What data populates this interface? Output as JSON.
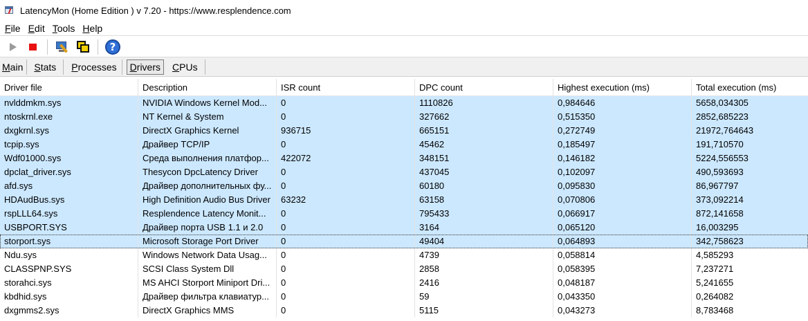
{
  "window": {
    "title": "LatencyMon  (Home Edition )  v 7.20 - https://www.resplendence.com"
  },
  "menu": [
    {
      "key": "F",
      "rest": "ile"
    },
    {
      "key": "E",
      "rest": "dit"
    },
    {
      "key": "T",
      "rest": "ools"
    },
    {
      "key": "H",
      "rest": "elp"
    }
  ],
  "toolbar": {
    "icons": [
      "play-icon",
      "stop-icon",
      "tools-icon",
      "windows-icon",
      "help-icon"
    ]
  },
  "tabs": [
    {
      "key": "M",
      "rest": "ain"
    },
    {
      "key": "S",
      "rest": "tats"
    },
    {
      "key": "P",
      "rest": "rocesses"
    },
    {
      "key": "D",
      "rest": "rivers"
    },
    {
      "key": "C",
      "rest": "PUs"
    }
  ],
  "active_tab": "Drivers",
  "columns": [
    "Driver file",
    "Description",
    "ISR count",
    "DPC count",
    "Highest execution (ms)",
    "Total execution (ms)"
  ],
  "rows": [
    {
      "file": "nvlddmkm.sys",
      "desc": "NVIDIA Windows Kernel Mod...",
      "isr": "0",
      "dpc": "1110826",
      "highest": "0,984646",
      "total": "5658,034305",
      "selected": true
    },
    {
      "file": "ntoskrnl.exe",
      "desc": "NT Kernel & System",
      "isr": "0",
      "dpc": "327662",
      "highest": "0,515350",
      "total": "2852,685223",
      "selected": true
    },
    {
      "file": "dxgkrnl.sys",
      "desc": "DirectX Graphics Kernel",
      "isr": "936715",
      "dpc": "665151",
      "highest": "0,272749",
      "total": "21972,764643",
      "selected": true
    },
    {
      "file": "tcpip.sys",
      "desc": "Драйвер TCP/IP",
      "isr": "0",
      "dpc": "45462",
      "highest": "0,185497",
      "total": "191,710570",
      "selected": true
    },
    {
      "file": "Wdf01000.sys",
      "desc": "Среда выполнения платфор...",
      "isr": "422072",
      "dpc": "348151",
      "highest": "0,146182",
      "total": "5224,556553",
      "selected": true
    },
    {
      "file": "dpclat_driver.sys",
      "desc": "Thesycon DpcLatency Driver",
      "isr": "0",
      "dpc": "437045",
      "highest": "0,102097",
      "total": "490,593693",
      "selected": true
    },
    {
      "file": "afd.sys",
      "desc": "Драйвер дополнительных фу...",
      "isr": "0",
      "dpc": "60180",
      "highest": "0,095830",
      "total": "86,967797",
      "selected": true
    },
    {
      "file": "HDAudBus.sys",
      "desc": "High Definition Audio Bus Driver",
      "isr": "63232",
      "dpc": "63158",
      "highest": "0,070806",
      "total": "373,092214",
      "selected": true
    },
    {
      "file": "rspLLL64.sys",
      "desc": "Resplendence Latency Monit...",
      "isr": "0",
      "dpc": "795433",
      "highest": "0,066917",
      "total": "872,141658",
      "selected": true
    },
    {
      "file": "USBPORT.SYS",
      "desc": "Драйвер порта USB 1.1 и 2.0",
      "isr": "0",
      "dpc": "3164",
      "highest": "0,065120",
      "total": "16,003295",
      "selected": true
    },
    {
      "file": "storport.sys",
      "desc": "Microsoft Storage Port Driver",
      "isr": "0",
      "dpc": "49404",
      "highest": "0,064893",
      "total": "342,758623",
      "selected": true,
      "focus": true
    },
    {
      "file": "Ndu.sys",
      "desc": "Windows Network Data Usag...",
      "isr": "0",
      "dpc": "4739",
      "highest": "0,058814",
      "total": "4,585293",
      "selected": false
    },
    {
      "file": "CLASSPNP.SYS",
      "desc": "SCSI Class System Dll",
      "isr": "0",
      "dpc": "2858",
      "highest": "0,058395",
      "total": "7,237271",
      "selected": false
    },
    {
      "file": "storahci.sys",
      "desc": "MS AHCI Storport Miniport Dri...",
      "isr": "0",
      "dpc": "2416",
      "highest": "0,048187",
      "total": "5,241655",
      "selected": false
    },
    {
      "file": "kbdhid.sys",
      "desc": "Драйвер фильтра клавиатур...",
      "isr": "0",
      "dpc": "59",
      "highest": "0,043350",
      "total": "0,264082",
      "selected": false
    },
    {
      "file": "dxgmms2.sys",
      "desc": "DirectX Graphics MMS",
      "isr": "0",
      "dpc": "5115",
      "highest": "0,043273",
      "total": "8,783468",
      "selected": false
    }
  ],
  "colors": {
    "selection": "#cce8ff",
    "stop": "#e81010",
    "help": "#2f6fd8"
  }
}
